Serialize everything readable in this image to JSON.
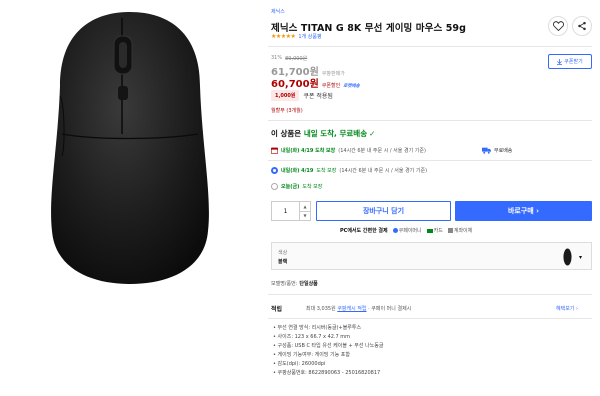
{
  "product": {
    "brand": "제닉스",
    "title": "제닉스 TITAN G 8K 무선 게이밍 마우스 59g",
    "rating_stars": 5,
    "review_count": "1개 상품평"
  },
  "share_label": "공유",
  "coupon_download": "쿠폰받기",
  "pricing": {
    "discount_rate": "31%",
    "original_price": "89,000원",
    "coupang_price": "61,700원",
    "coupang_price_label": "쿠팡판매가",
    "coupon_price": "60,700원",
    "coupon_price_label": "쿠폰할인",
    "rocket_label": "로켓배송",
    "coupon_amount": "1,000원",
    "coupon_applied": "쿠폰 적용됨",
    "installment": "월할부 (3개월)"
  },
  "delivery": {
    "heading_prefix": "이 상품은 ",
    "heading_emph": "내일 도착, 무료배송",
    "heading_check": "✓",
    "row1_date": "내일(화) 4/19 도착 보장",
    "row1_note": "(14시간 6분 내 주문 시 / 서울 경기 기준)",
    "free_ship": "무료배송",
    "opt1_date": "내일(화) 4/19",
    "opt1_guarantee": "도착 보장",
    "opt1_note": "(14시간 6분 내 주문 시 / 서울 경기 기준)",
    "opt2_date": "오늘(금)",
    "opt2_guarantee": "도착 보장"
  },
  "quantity": "1",
  "cart_button": "장바구니 담기",
  "buy_button": "바로구매 ›",
  "payment": {
    "label": "PC에서도 간편한 결제",
    "items": [
      "쿠페이머니",
      "카드",
      "계좌이체"
    ]
  },
  "option": {
    "label": "색상",
    "value": "블랙"
  },
  "model_label": "모델명/품번:",
  "model_value": "단일상품",
  "cash": {
    "label": "적립",
    "text_prefix": "최대 3,035원",
    "text_link": "쿠팡캐시 적립",
    "text_suffix": " · 쿠페이 머니 결제시",
    "benefit_link": "혜택보기 ›"
  },
  "specs": [
    "무선 연결 방식: 리시버(동글)+블루투스",
    "사이즈: 123 x 66.7 x 42.7 mm",
    "구성품: USB C 타입 유선 케이블 + 무선 나노동글",
    "게이밍 기능여부: 게이밍 기능 포함",
    "감도(dpi): 26000dpi",
    "쿠팡상품번호: 8622890063 - 25016820817"
  ],
  "icons": {
    "heart": "heart-icon",
    "share": "share-icon",
    "download": "download-icon",
    "calendar": "calendar-icon",
    "truck": "truck-icon",
    "chevron": "chevron-down-icon"
  },
  "colors": {
    "blue": "#346aff",
    "red": "#ae0000",
    "green": "#00891a",
    "stars": "#f29500"
  }
}
